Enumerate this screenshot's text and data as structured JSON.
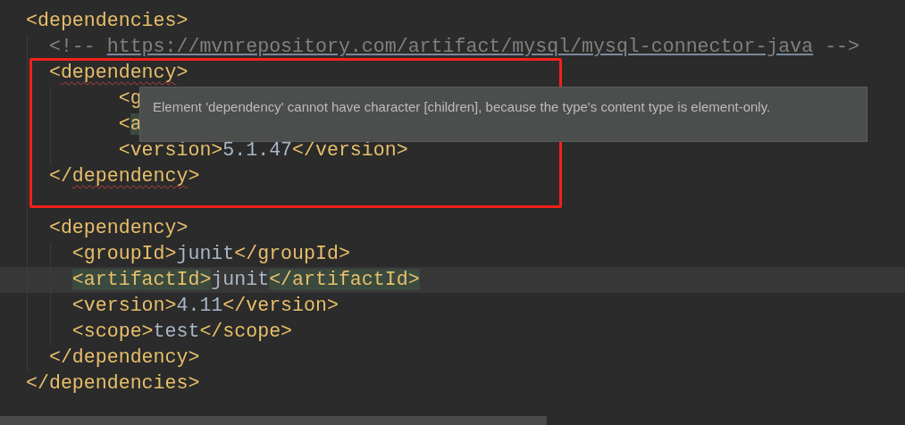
{
  "editor": {
    "lines": [
      {
        "current": false,
        "tokens": [
          {
            "kind": "tag",
            "text": "<dependencies>"
          }
        ]
      },
      {
        "current": false,
        "tokens": [
          {
            "kind": "comment",
            "text": "  <!-- "
          },
          {
            "kind": "link",
            "text": "https://mvnrepository.com/artifact/mysql/mysql-connector-java"
          },
          {
            "kind": "comment",
            "text": " -->"
          }
        ]
      },
      {
        "current": false,
        "tokens": [
          {
            "kind": "tag",
            "text": "  <"
          },
          {
            "kind": "tag",
            "text": "dependency",
            "error": true
          },
          {
            "kind": "tag",
            "text": ">"
          }
        ]
      },
      {
        "current": false,
        "tokens": [
          {
            "kind": "tag",
            "text": "        <g"
          }
        ]
      },
      {
        "current": false,
        "tokens": [
          {
            "kind": "tag",
            "text": "        <"
          },
          {
            "kind": "tag",
            "text": "a",
            "matched": true
          }
        ]
      },
      {
        "current": false,
        "tokens": [
          {
            "kind": "tag",
            "text": "        <version>"
          },
          {
            "kind": "value",
            "text": "5.1.47"
          },
          {
            "kind": "tag",
            "text": "</version>"
          }
        ]
      },
      {
        "current": false,
        "tokens": [
          {
            "kind": "tag",
            "text": "  </"
          },
          {
            "kind": "tag",
            "text": "dependency",
            "error": true
          },
          {
            "kind": "tag",
            "text": ">"
          }
        ]
      },
      {
        "current": false
      },
      {
        "current": false,
        "tokens": [
          {
            "kind": "tag",
            "text": "  <dependency>"
          }
        ]
      },
      {
        "current": false,
        "tokens": [
          {
            "kind": "tag",
            "text": "    <groupId>"
          },
          {
            "kind": "value",
            "text": "junit"
          },
          {
            "kind": "tag",
            "text": "</groupId>"
          }
        ]
      },
      {
        "current": true,
        "tokens": [
          {
            "kind": "tag",
            "text": "    <artifactId>",
            "matched": true
          },
          {
            "kind": "value",
            "text": "junit"
          },
          {
            "kind": "tag",
            "text": "</artifactId>",
            "matched": true
          }
        ]
      },
      {
        "current": false,
        "tokens": [
          {
            "kind": "tag",
            "text": "    <version>"
          },
          {
            "kind": "value",
            "text": "4.11"
          },
          {
            "kind": "tag",
            "text": "</version>"
          }
        ]
      },
      {
        "current": false,
        "tokens": [
          {
            "kind": "tag",
            "text": "    <scope>"
          },
          {
            "kind": "value",
            "text": "test"
          },
          {
            "kind": "tag",
            "text": "</scope>"
          }
        ]
      },
      {
        "current": false,
        "tokens": [
          {
            "kind": "tag",
            "text": "  </dependency>"
          }
        ]
      },
      {
        "current": false,
        "tokens": [
          {
            "kind": "tag",
            "text": "</dependencies>"
          }
        ]
      }
    ]
  },
  "tooltip": {
    "text": "Element 'dependency' cannot have character [children], because the type's content type is element-only."
  }
}
